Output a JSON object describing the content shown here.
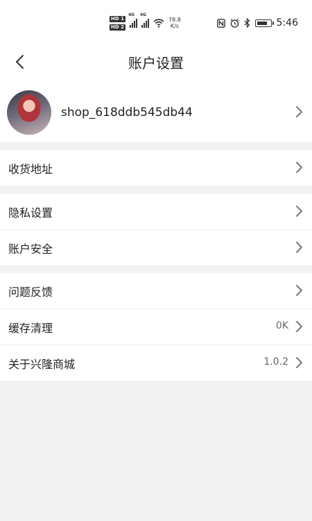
{
  "status_bar": {
    "net_speed_value": "78.8",
    "net_speed_unit": "K/s",
    "hd1": "HD 1",
    "hd2": "HD 2",
    "sim1": "4G",
    "sim2": "4G",
    "time": "5:46"
  },
  "header": {
    "title": "账户设置"
  },
  "profile": {
    "username": "shop_618ddb545db44"
  },
  "groups": [
    {
      "items": [
        {
          "label": "收货地址",
          "value": ""
        }
      ]
    },
    {
      "items": [
        {
          "label": "隐私设置",
          "value": ""
        },
        {
          "label": "账户安全",
          "value": ""
        }
      ]
    },
    {
      "items": [
        {
          "label": "问题反馈",
          "value": ""
        },
        {
          "label": "缓存清理",
          "value": "0K"
        },
        {
          "label": "关于兴隆商城",
          "value": "1.0.2"
        }
      ]
    }
  ],
  "colors": {
    "background": "#f2f2f2",
    "card": "#ffffff",
    "chevron": "#888888"
  }
}
